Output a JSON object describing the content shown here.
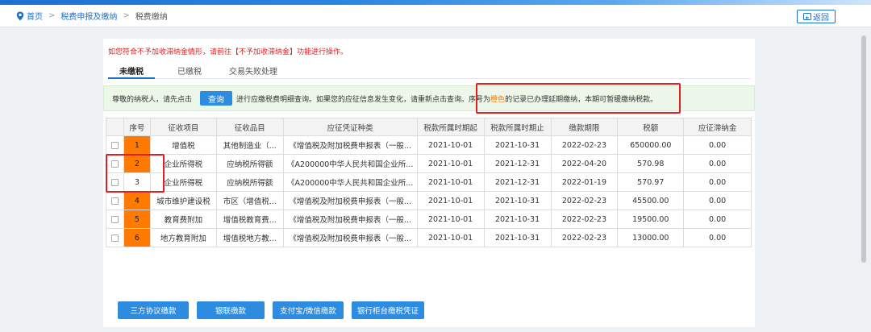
{
  "breadcrumb": {
    "home": "首页",
    "level2": "税费申报及缴纳",
    "current": "税费缴纳"
  },
  "back_label": "返回",
  "notice": "如您符合不予加收滞纳金情形，请前往【不予加收滞纳金】功能进行操作。",
  "tabs": [
    "未缴税",
    "已缴税",
    "交易失败处理"
  ],
  "info": {
    "prefix": "尊敬的纳税人，请先点击",
    "query_label": "查询",
    "middle": "进行应缴税费明细查询。如果您的应征信息发生变化，请重新点击查询。",
    "hl_prefix": "序号为",
    "hl_word": "橙色",
    "hl_suffix": "的记录已办理延期缴纳，本期可暂缓缴纳税款。"
  },
  "table": {
    "headers": [
      "序号",
      "征收项目",
      "征收品目",
      "应征凭证种类",
      "税款所属时期起",
      "税款所属时期止",
      "缴款期限",
      "税额",
      "应征滞纳金"
    ],
    "rows": [
      {
        "seq": "1",
        "item": "增值税",
        "sub": "其他制造业（...",
        "voucher": "《增值税及附加税费申报表（一般...",
        "start": "2021-10-01",
        "end": "2021-10-31",
        "deadline": "2022-02-23",
        "amount": "650000.00",
        "late_fee": "0.00",
        "orange": true
      },
      {
        "seq": "2",
        "item": "企业所得税",
        "sub": "应纳税所得额",
        "voucher": "《A200000中华人民共和国企业所...",
        "start": "2021-10-01",
        "end": "2021-12-31",
        "deadline": "2022-04-20",
        "amount": "570.98",
        "late_fee": "0.00",
        "orange": true
      },
      {
        "seq": "3",
        "item": "企业所得税",
        "sub": "应纳税所得额",
        "voucher": "《A200000中华人民共和国企业所...",
        "start": "2021-10-01",
        "end": "2021-12-31",
        "deadline": "2022-01-19",
        "amount": "570.97",
        "late_fee": "0.00",
        "orange": false
      },
      {
        "seq": "4",
        "item": "城市维护建设税",
        "sub": "市区（增值税...",
        "voucher": "《增值税及附加税费申报表（一般...",
        "start": "2021-10-01",
        "end": "2021-10-31",
        "deadline": "2022-02-23",
        "amount": "45500.00",
        "late_fee": "0.00",
        "orange": true
      },
      {
        "seq": "5",
        "item": "教育费附加",
        "sub": "增值税教育费...",
        "voucher": "《增值税及附加税费申报表（一般...",
        "start": "2021-10-01",
        "end": "2021-10-31",
        "deadline": "2022-02-23",
        "amount": "19500.00",
        "late_fee": "0.00",
        "orange": true
      },
      {
        "seq": "6",
        "item": "地方教育附加",
        "sub": "增值税地方教...",
        "voucher": "《增值税及附加税费申报表（一般...",
        "start": "2021-10-01",
        "end": "2021-10-31",
        "deadline": "2022-02-23",
        "amount": "13000.00",
        "late_fee": "0.00",
        "orange": true
      }
    ]
  },
  "buttons": [
    "三方协议缴款",
    "银联缴款",
    "支付宝/微信缴款",
    "银行柜台缴税凭证"
  ],
  "colors": {
    "accent": "#2d8ce0",
    "orange": "#ff7a00",
    "highlight_red": "#e02020",
    "info_bg": "#ecf7ea"
  },
  "icons": {
    "home": "location-pin-icon",
    "back": "return-arrow-icon"
  }
}
